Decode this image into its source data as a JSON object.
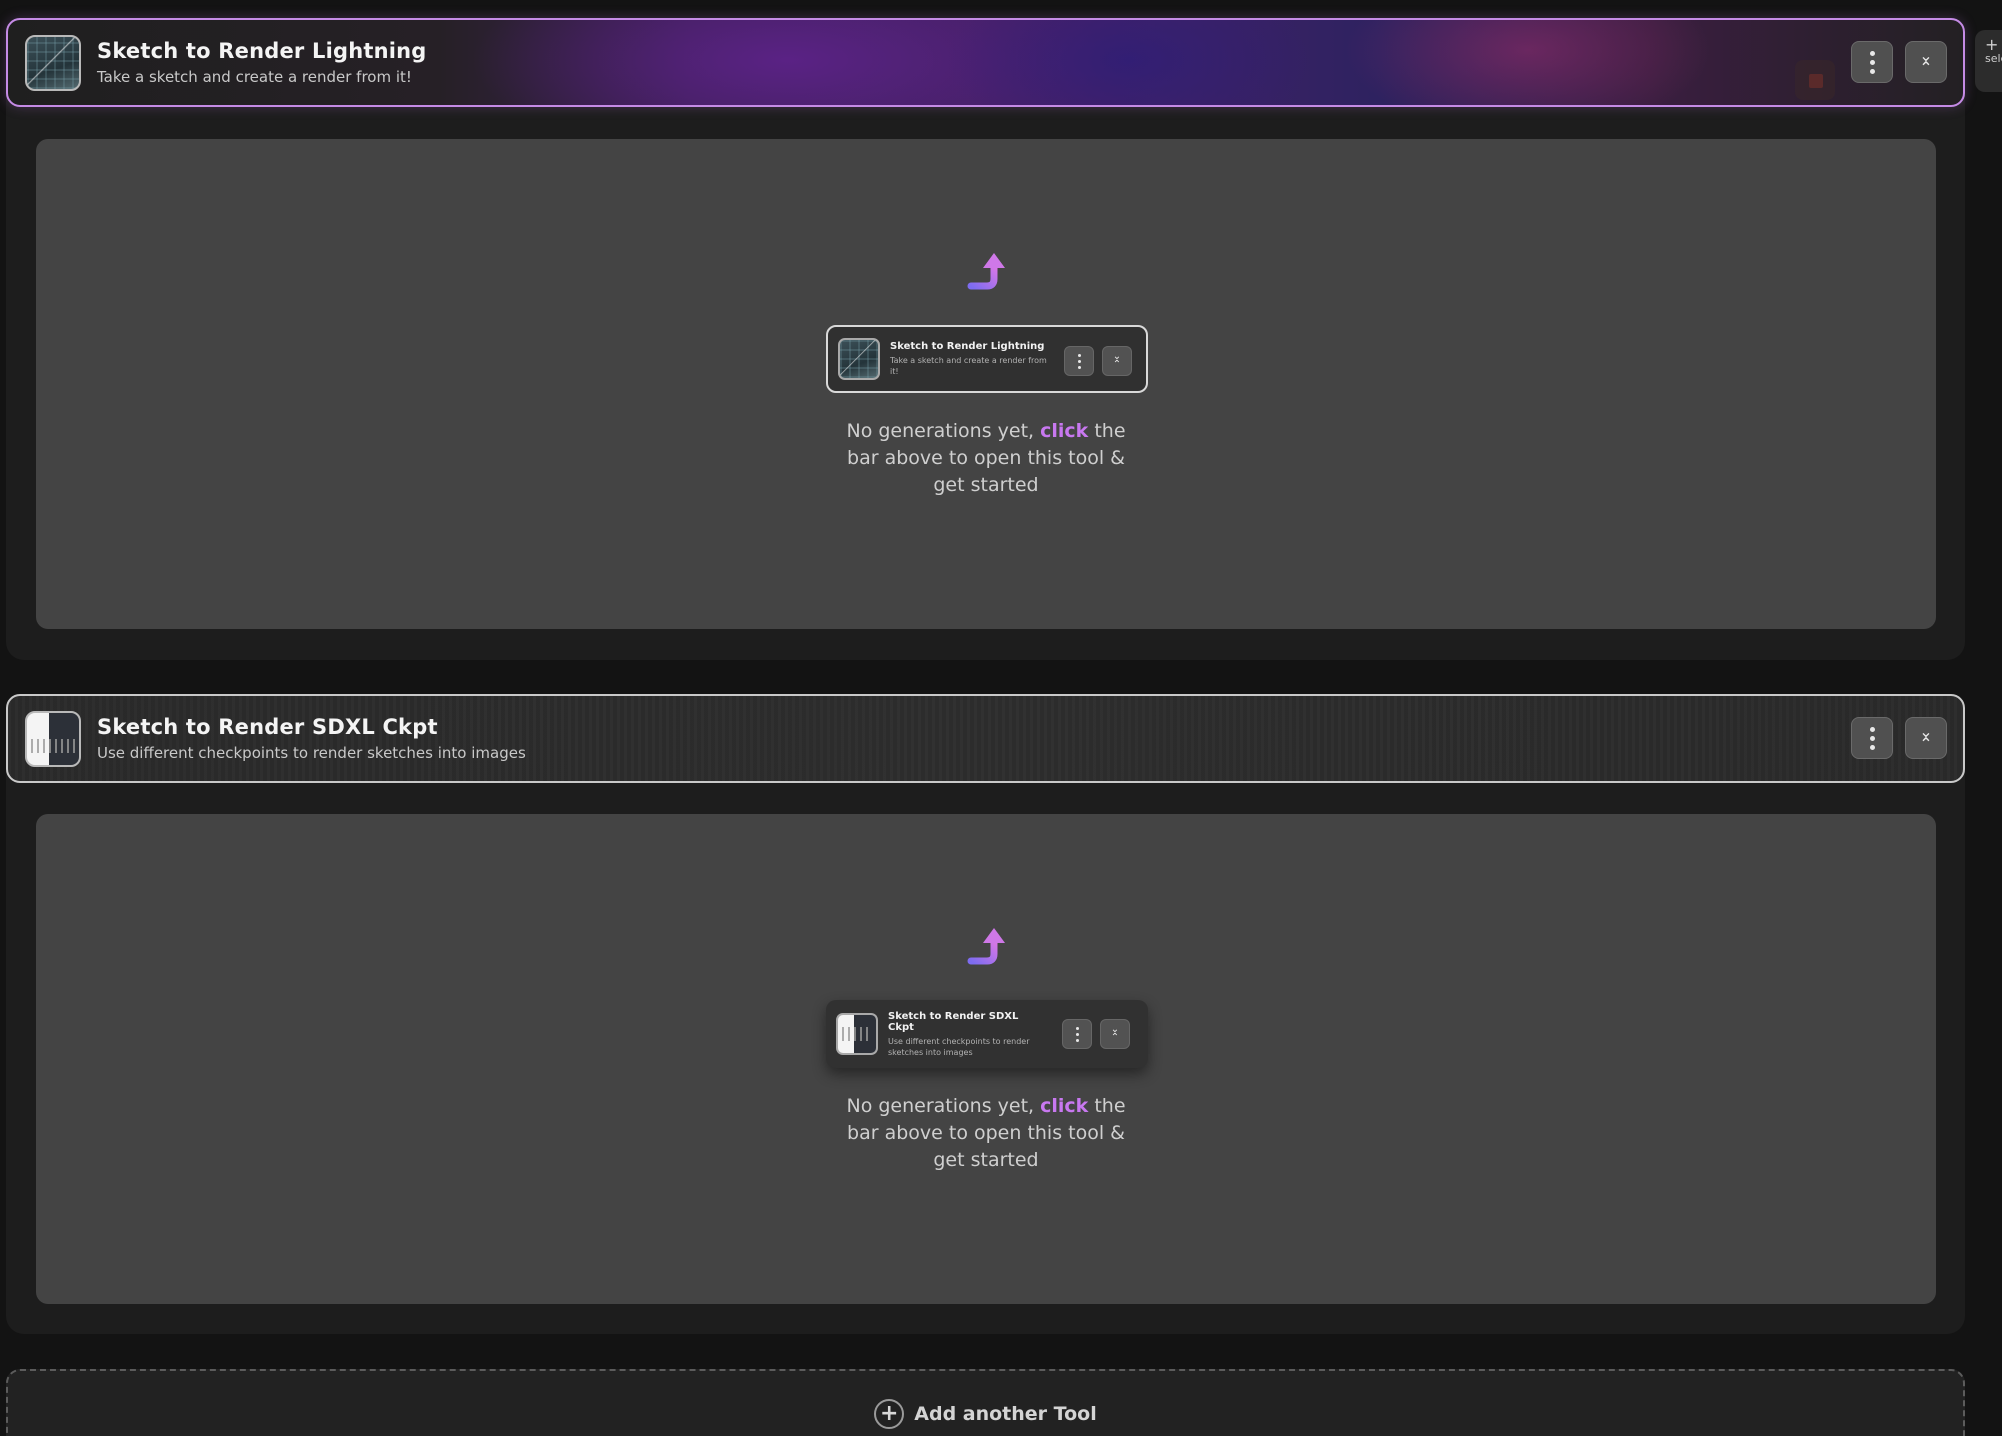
{
  "tools": [
    {
      "title": "Sketch to Render Lightning",
      "subtitle": "Take a sketch and create a render from it!",
      "mini_subtitle": "Take a sketch and create a render from it!",
      "icon": "sketch-lightning-thumbnail",
      "accent": "#c58be6"
    },
    {
      "title": "Sketch to Render SDXL Ckpt",
      "subtitle": "Use different checkpoints to render sketches into images",
      "mini_subtitle": "Use different checkpoints to render sketches into images",
      "icon": "sketch-sdxl-thumbnail",
      "accent": "#c9c9c9"
    }
  ],
  "empty_state": {
    "before": "No generations yet, ",
    "highlight": "click",
    "after": " the bar above to open this tool & get started",
    "highlight_color": "#c878f0"
  },
  "add_tool": {
    "label": "Add another Tool",
    "icon": "plus-circle-icon"
  },
  "side_chip": {
    "text": "sele"
  },
  "icons": {
    "menu": "more-vertical-icon",
    "collapse": "collapse-expand-icon",
    "arrow": "curved-arrow-up-icon"
  }
}
